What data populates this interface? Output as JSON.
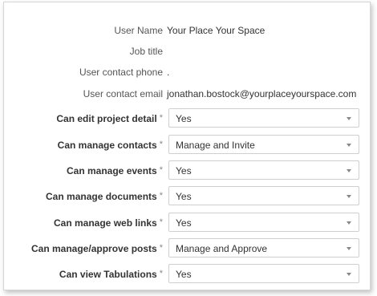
{
  "info": [
    {
      "label": "User Name",
      "value": "Your Place Your Space"
    },
    {
      "label": "Job title",
      "value": ""
    },
    {
      "label": "User contact phone",
      "value": "."
    },
    {
      "label": "User contact email",
      "value": "jonathan.bostock@yourplaceyourspace.com"
    }
  ],
  "required_marker": "*",
  "permissions": [
    {
      "label": "Can edit project detail",
      "selected": "Yes"
    },
    {
      "label": "Can manage contacts",
      "selected": "Manage and Invite"
    },
    {
      "label": "Can manage events",
      "selected": "Yes"
    },
    {
      "label": "Can manage documents",
      "selected": "Yes"
    },
    {
      "label": "Can manage web links",
      "selected": "Yes"
    },
    {
      "label": "Can manage/approve posts",
      "selected": "Manage and Approve"
    },
    {
      "label": "Can view Tabulations",
      "selected": "Yes"
    }
  ],
  "icons": {
    "dropdown": "chevron-down-icon"
  },
  "colors": {
    "border": "#cfcfcf",
    "label": "#555555",
    "text": "#333333"
  }
}
